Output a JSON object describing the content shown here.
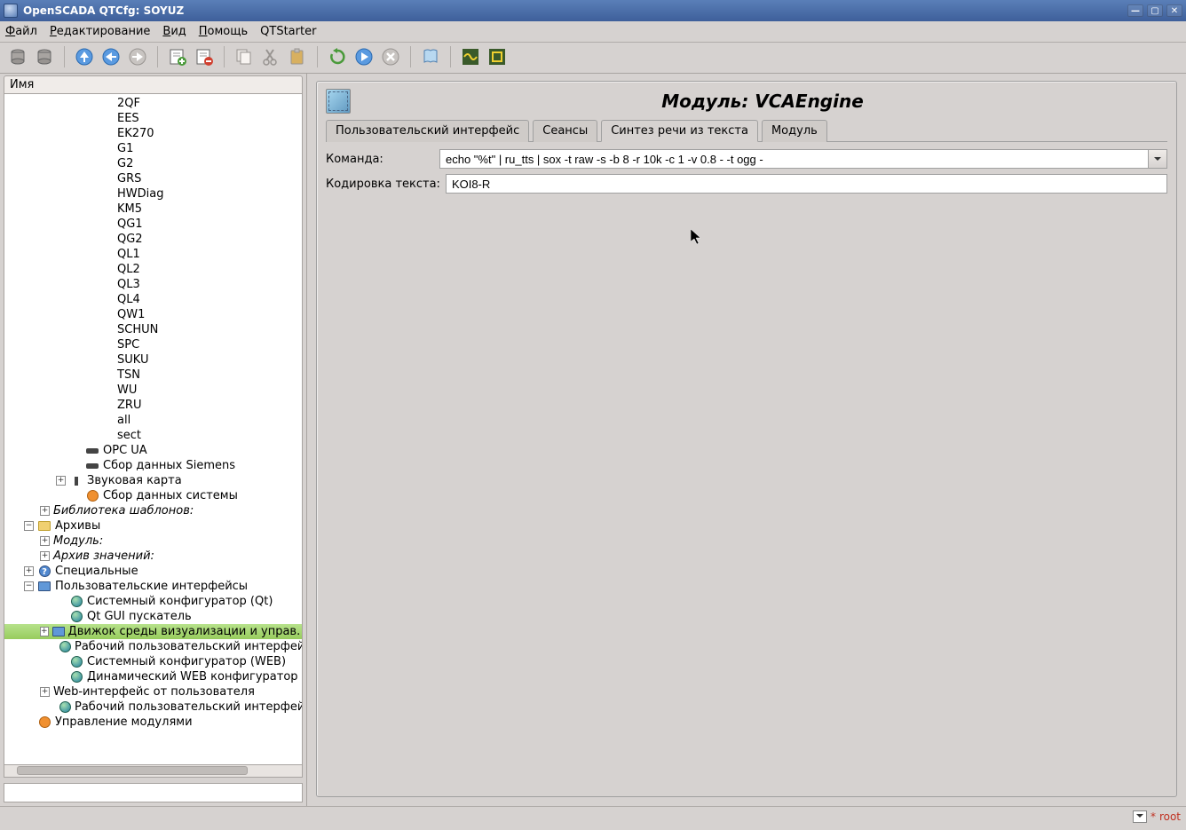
{
  "window": {
    "title": "OpenSCADA QTCfg: SOYUZ"
  },
  "menu": {
    "file": "Файл",
    "edit": "Редактирование",
    "view": "Вид",
    "help": "Помощь",
    "qtstarter": "QTStarter"
  },
  "tree": {
    "header": "Имя",
    "plain_items": [
      "2QF",
      "EES",
      "EK270",
      "G1",
      "G2",
      "GRS",
      "HWDiag",
      "KM5",
      "QG1",
      "QG2",
      "QL1",
      "QL2",
      "QL3",
      "QL4",
      "QW1",
      "SCHUN",
      "SPC",
      "SUKU",
      "TSN",
      "WU",
      "ZRU",
      "all",
      "sect"
    ],
    "opcua": "OPC UA",
    "siemens": "Сбор данных Siemens",
    "sound": "Звуковая карта",
    "sysdata": "Сбор данных системы",
    "tpl_lib": "Библиотека шаблонов:",
    "archives": "Архивы",
    "arch_module": "Модуль:",
    "arch_values": "Архив значений:",
    "special": "Специальные",
    "ui": "Пользовательские интерфейсы",
    "ui_qtcfg": "Системный конфигуратор (Qt)",
    "ui_qtstarter": "Qt GUI пускатель",
    "ui_vcaengine": "Движок среды визуализации и управ.",
    "ui_webui": "Рабочий пользовательский интерфей",
    "ui_webcfg": "Системный конфигуратор (WEB)",
    "ui_webdyn": "Динамический WEB конфигуратор",
    "ui_webuser": "Web-интерфейс от пользователя",
    "ui_webvision": "Рабочий пользовательский интерфей",
    "modsched": "Управление модулями"
  },
  "panel": {
    "title": "Модуль: VCAEngine",
    "tabs": {
      "ui": "Пользовательский интерфейс",
      "sessions": "Сеансы",
      "tts": "Синтез речи из текста",
      "module": "Модуль"
    },
    "form": {
      "command_label": "Команда:",
      "command_value": "echo \"%t\" | ru_tts | sox -t raw -s -b 8 -r 10k -c 1 -v 0.8 - -t ogg -",
      "encoding_label": "Кодировка текста:",
      "encoding_value": "KOI8-R"
    }
  },
  "status": {
    "marker": "*",
    "user": "root"
  },
  "filter": {
    "placeholder": ""
  }
}
